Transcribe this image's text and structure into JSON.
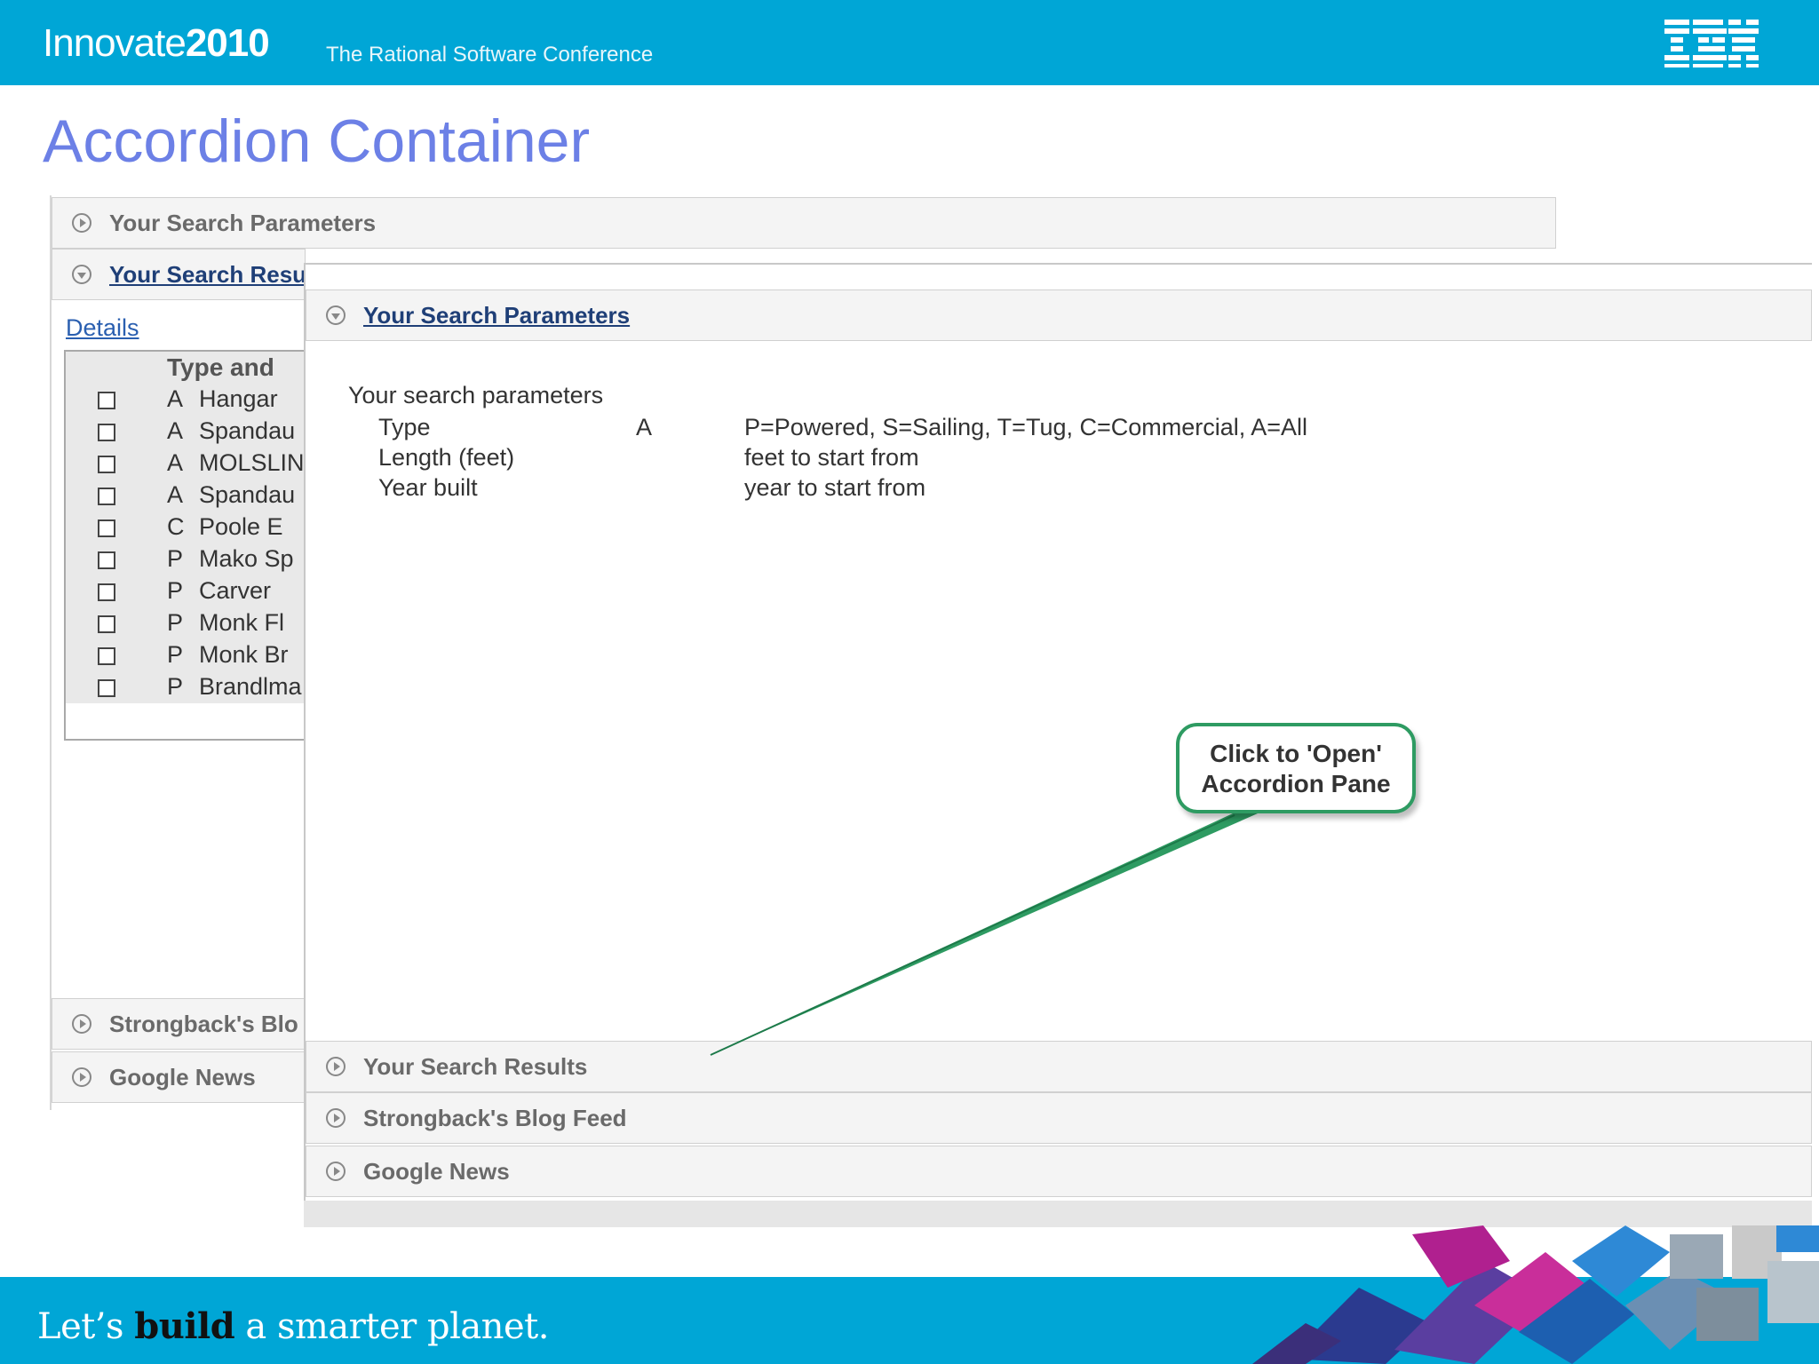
{
  "header": {
    "brand_word": "Innovate",
    "brand_year": "2010",
    "subtitle": "The Rational Software Conference",
    "logo_text": "IBM"
  },
  "page_title": "Accordion Container",
  "back_panel": {
    "headers": {
      "search_parameters": "Your Search Parameters",
      "search_results": "Your Search Resu",
      "blog_feed": "Strongback's Blo",
      "google_news": "Google News"
    },
    "details_link": "Details",
    "table": {
      "header": "Type  and",
      "rows": [
        {
          "type": "A",
          "name": "Hangar"
        },
        {
          "type": "A",
          "name": "Spandau"
        },
        {
          "type": "A",
          "name": "MOLSLIN"
        },
        {
          "type": "A",
          "name": "Spandau"
        },
        {
          "type": "C",
          "name": "Poole   E"
        },
        {
          "type": "P",
          "name": "Mako  Sp"
        },
        {
          "type": "P",
          "name": "Carver"
        },
        {
          "type": "P",
          "name": "Monk  Fl"
        },
        {
          "type": "P",
          "name": "Monk  Br"
        },
        {
          "type": "P",
          "name": "Brandlma"
        }
      ]
    }
  },
  "front_panel": {
    "headers": {
      "search_parameters": "Your Search Parameters",
      "search_results": "Your Search Results",
      "blog_feed": "Strongback's Blog Feed",
      "google_news": "Google News"
    },
    "params": {
      "heading": "Your search parameters",
      "rows": [
        {
          "label": "Type",
          "value": "A",
          "desc": "P=Powered, S=Sailing, T=Tug, C=Commercial, A=All"
        },
        {
          "label": "Length (feet)",
          "value": "",
          "desc": "feet to start from"
        },
        {
          "label": "Year built",
          "value": "",
          "desc": "year to start from"
        }
      ]
    }
  },
  "callout": {
    "line1": "Click to 'Open'",
    "line2": "Accordion Pane",
    "color": "#2e9b62"
  },
  "footer": {
    "tagline_pre": "Let’s ",
    "tagline_bold": "build",
    "tagline_post": " a smarter planet."
  },
  "colors": {
    "brand_blue": "#00a6d6",
    "title_blue": "#6c80e6",
    "link_blue": "#2a5fb0"
  }
}
